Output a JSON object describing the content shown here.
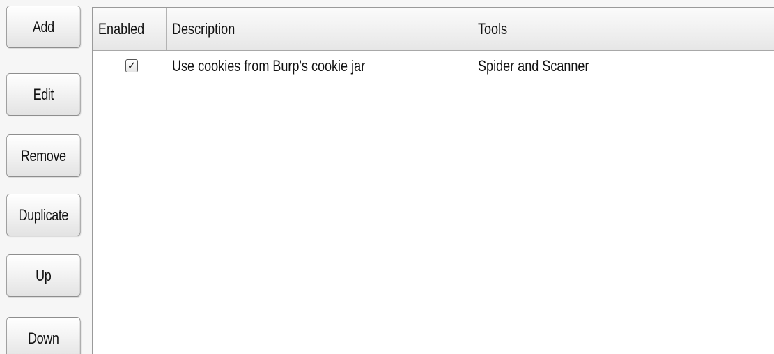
{
  "buttons": {
    "add": "Add",
    "edit": "Edit",
    "remove": "Remove",
    "duplicate": "Duplicate",
    "up": "Up",
    "down": "Down"
  },
  "table": {
    "columns": [
      "Enabled",
      "Description",
      "Tools"
    ],
    "rows": [
      {
        "enabled": true,
        "enabled_glyph": "✓",
        "description": "Use cookies from Burp's cookie jar",
        "tools": "Spider and Scanner"
      }
    ]
  }
}
